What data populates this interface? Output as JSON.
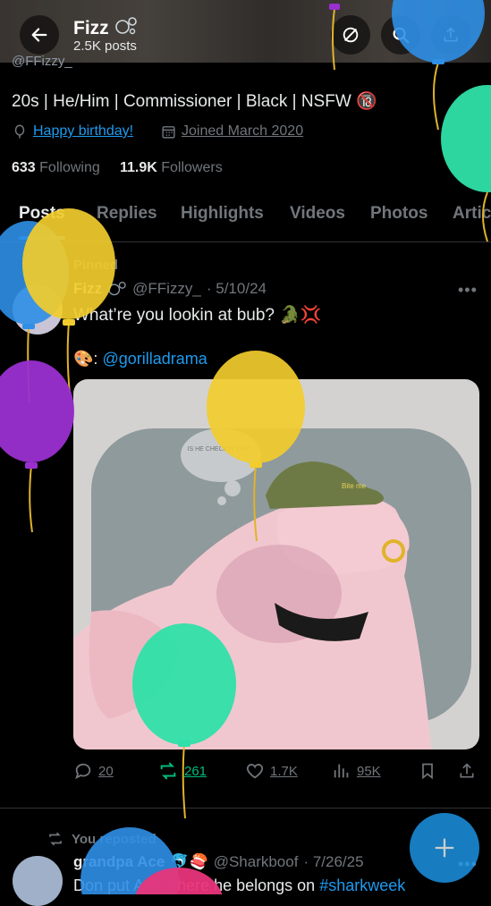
{
  "header": {
    "name": "Fizz",
    "posts_count": "2.5K posts",
    "handle_peek": "@FFizzy_"
  },
  "profile": {
    "bio": "20s | He/Him | Commissioner | Black | NSFW 🔞",
    "birthday_link": "Happy birthday!",
    "joined": "Joined March 2020",
    "following_count": "633",
    "following_label": "Following",
    "followers_count": "11.9K",
    "followers_label": "Followers"
  },
  "tabs": [
    "Posts",
    "Replies",
    "Highlights",
    "Videos",
    "Photos",
    "Artic"
  ],
  "pinned_post": {
    "pinned_label": "Pinned",
    "name": "Fizz",
    "handle": "@FFizzy_",
    "date": "· 5/10/24",
    "text": "What’re you lookin at bub? 🐊💢",
    "credit_emoji": "🎨:",
    "credit_handle": "@gorilladrama",
    "hat_text": "Bite me",
    "thought_text": "IS HE CHECKIN' OUT...",
    "replies": "20",
    "reposts": "261",
    "likes": "1.7K",
    "views": "95K"
  },
  "reposted_post": {
    "repost_label": "You reposted",
    "name": "grandpa Ace",
    "emojis": "🐬🍣",
    "handle": "@Sharkboof",
    "date": "· 7/26/25",
    "text_prefix": "Don put Ace where he belongs on ",
    "hashtag": "#sharkweek"
  },
  "colors": {
    "accent": "#1d9bf0",
    "balloon_blue": "#2f8fe6",
    "balloon_yellow": "#f2cc2c",
    "balloon_green": "#2fe0a8",
    "balloon_purple": "#9a2fd0",
    "balloon_pink": "#e8347a"
  },
  "icons": {
    "back": "arrow-left-icon",
    "mute": "bell-slash-icon",
    "search": "search-icon",
    "share": "share-icon",
    "compose": "plus-icon"
  }
}
